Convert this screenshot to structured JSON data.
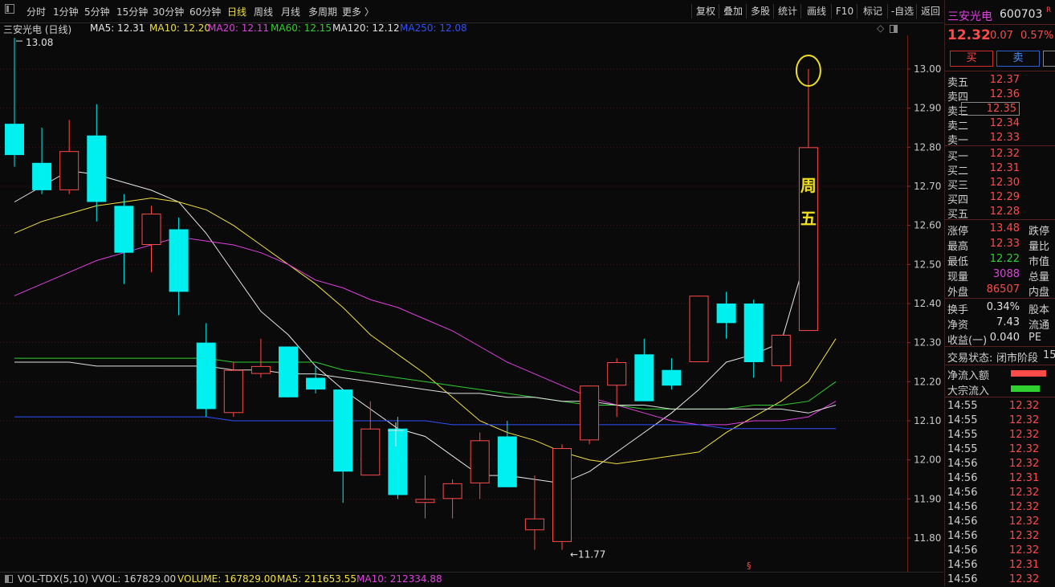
{
  "toolbar": {
    "periods": [
      "分时",
      "1分钟",
      "5分钟",
      "15分钟",
      "30分钟",
      "60分钟",
      "日线",
      "周线",
      "月线",
      "多周期",
      "更多 〉"
    ],
    "active_period": "日线",
    "right_buttons": [
      "复权",
      "叠加",
      "多股",
      "统计",
      "画线",
      "F10",
      "标记",
      "-自选",
      "返回"
    ]
  },
  "info_line": {
    "title": "三安光电 (日线)",
    "ma": [
      {
        "label": "MA5: 12.31",
        "color": "#e8e8e8"
      },
      {
        "label": "MA10: 12.20",
        "color": "#f0e040"
      },
      {
        "label": "MA20: 12.11",
        "color": "#e040e0"
      },
      {
        "label": "MA60: 12.15",
        "color": "#30d030"
      },
      {
        "label": "MA120: 12.12",
        "color": "#e0e0e0"
      },
      {
        "label": "MA250: 12.08",
        "color": "#3050ff"
      }
    ]
  },
  "annotation": {
    "line1": "周",
    "line2": "五",
    "color": "#f0e020"
  },
  "markers": {
    "high_label": "13.08",
    "low_label": "←11.77",
    "small_mark": "§"
  },
  "chart_data": {
    "type": "candlestick",
    "y_ticks": [
      "13.00",
      "12.90",
      "12.80",
      "12.70",
      "12.60",
      "12.50",
      "12.40",
      "12.30",
      "12.20",
      "12.10",
      "12.00",
      "11.90",
      "11.80"
    ],
    "ylim": [
      11.77,
      13.08
    ],
    "candles": [
      {
        "o": 12.86,
        "h": 13.08,
        "l": 12.75,
        "c": 12.78
      },
      {
        "o": 12.76,
        "h": 12.85,
        "l": 12.68,
        "c": 12.69
      },
      {
        "o": 12.69,
        "h": 12.87,
        "l": 12.68,
        "c": 12.79
      },
      {
        "o": 12.83,
        "h": 12.91,
        "l": 12.61,
        "c": 12.66
      },
      {
        "o": 12.65,
        "h": 12.68,
        "l": 12.45,
        "c": 12.53
      },
      {
        "o": 12.55,
        "h": 12.65,
        "l": 12.48,
        "c": 12.63
      },
      {
        "o": 12.59,
        "h": 12.62,
        "l": 12.37,
        "c": 12.43
      },
      {
        "o": 12.3,
        "h": 12.35,
        "l": 12.11,
        "c": 12.13
      },
      {
        "o": 12.12,
        "h": 12.25,
        "l": 12.11,
        "c": 12.23
      },
      {
        "o": 12.22,
        "h": 12.31,
        "l": 12.21,
        "c": 12.24
      },
      {
        "o": 12.29,
        "h": 12.29,
        "l": 12.16,
        "c": 12.16
      },
      {
        "o": 12.21,
        "h": 12.24,
        "l": 12.17,
        "c": 12.18
      },
      {
        "o": 12.18,
        "h": 12.18,
        "l": 11.89,
        "c": 11.97
      },
      {
        "o": 11.96,
        "h": 12.15,
        "l": 11.96,
        "c": 12.08
      },
      {
        "o": 12.08,
        "h": 12.11,
        "l": 11.9,
        "c": 11.91
      },
      {
        "o": 11.89,
        "h": 11.96,
        "l": 11.85,
        "c": 11.9
      },
      {
        "o": 11.9,
        "h": 11.95,
        "l": 11.85,
        "c": 11.94
      },
      {
        "o": 11.94,
        "h": 12.07,
        "l": 11.9,
        "c": 12.05
      },
      {
        "o": 12.06,
        "h": 12.1,
        "l": 11.93,
        "c": 11.93
      },
      {
        "o": 11.82,
        "h": 11.96,
        "l": 11.77,
        "c": 11.85
      },
      {
        "o": 11.79,
        "h": 12.04,
        "l": 11.77,
        "c": 12.03
      },
      {
        "o": 12.05,
        "h": 12.19,
        "l": 12.04,
        "c": 12.19
      },
      {
        "o": 12.19,
        "h": 12.26,
        "l": 12.11,
        "c": 12.25
      },
      {
        "o": 12.27,
        "h": 12.31,
        "l": 12.15,
        "c": 12.15
      },
      {
        "o": 12.23,
        "h": 12.26,
        "l": 12.18,
        "c": 12.19
      },
      {
        "o": 12.25,
        "h": 12.42,
        "l": 12.25,
        "c": 12.42
      },
      {
        "o": 12.4,
        "h": 12.43,
        "l": 12.31,
        "c": 12.35
      },
      {
        "o": 12.4,
        "h": 12.41,
        "l": 12.21,
        "c": 12.25
      },
      {
        "o": 12.24,
        "h": 12.32,
        "l": 12.2,
        "c": 12.32
      },
      {
        "o": 12.33,
        "h": 13.0,
        "l": 12.33,
        "c": 12.8
      }
    ],
    "ma_lines": [
      {
        "name": "MA5",
        "color": "#e8e8e8",
        "values": [
          12.66,
          12.7,
          12.74,
          12.73,
          12.71,
          12.69,
          12.66,
          12.58,
          12.48,
          12.38,
          12.32,
          12.24,
          12.18,
          12.13,
          12.08,
          12.06,
          12.01,
          11.96,
          11.96,
          11.95,
          11.94,
          11.97,
          12.02,
          12.07,
          12.12,
          12.18,
          12.25,
          12.27,
          12.3,
          12.54
        ]
      },
      {
        "name": "MA10",
        "color": "#f0e040",
        "values": [
          12.58,
          12.61,
          12.63,
          12.65,
          12.66,
          12.67,
          12.66,
          12.64,
          12.6,
          12.55,
          12.5,
          12.45,
          12.39,
          12.32,
          12.27,
          12.22,
          12.16,
          12.1,
          12.07,
          12.05,
          12.02,
          12.0,
          11.99,
          12.0,
          12.01,
          12.02,
          12.07,
          12.11,
          12.15,
          12.2,
          12.31
        ]
      },
      {
        "name": "MA20",
        "color": "#e040e0",
        "values": [
          12.42,
          12.45,
          12.48,
          12.51,
          12.53,
          12.55,
          12.57,
          12.56,
          12.55,
          12.53,
          12.5,
          12.46,
          12.44,
          12.41,
          12.39,
          12.36,
          12.33,
          12.29,
          12.25,
          12.22,
          12.19,
          12.16,
          12.14,
          12.12,
          12.1,
          12.09,
          12.09,
          12.1,
          12.1,
          12.11,
          12.15
        ]
      },
      {
        "name": "MA60",
        "color": "#30d030",
        "values": [
          12.26,
          12.26,
          12.26,
          12.26,
          12.26,
          12.26,
          12.26,
          12.26,
          12.25,
          12.25,
          12.25,
          12.25,
          12.23,
          12.22,
          12.21,
          12.2,
          12.19,
          12.18,
          12.17,
          12.16,
          12.15,
          12.14,
          12.14,
          12.13,
          12.13,
          12.13,
          12.13,
          12.14,
          12.14,
          12.15,
          12.2
        ]
      },
      {
        "name": "MA120",
        "color": "#e0e0e0",
        "values": [
          12.25,
          12.25,
          12.25,
          12.24,
          12.24,
          12.24,
          12.24,
          12.24,
          12.23,
          12.23,
          12.22,
          12.22,
          12.21,
          12.2,
          12.19,
          12.18,
          12.17,
          12.17,
          12.16,
          12.16,
          12.15,
          12.15,
          12.14,
          12.14,
          12.13,
          12.13,
          12.13,
          12.13,
          12.13,
          12.12,
          12.14
        ]
      },
      {
        "name": "MA250",
        "color": "#3050ff",
        "values": [
          12.11,
          12.11,
          12.11,
          12.11,
          12.11,
          12.11,
          12.11,
          12.11,
          12.1,
          12.1,
          12.1,
          12.1,
          12.1,
          12.1,
          12.1,
          12.1,
          12.09,
          12.09,
          12.09,
          12.09,
          12.09,
          12.09,
          12.09,
          12.09,
          12.09,
          12.09,
          12.08,
          12.08,
          12.08,
          12.08,
          12.08
        ]
      }
    ]
  },
  "volume_bar": {
    "items": [
      {
        "label": "VOL-TDX(5,10)",
        "color": "#d0d0d0"
      },
      {
        "label": "VVOL: 167829.00",
        "color": "#d0d0d0"
      },
      {
        "label": "VOLUME: 167829.00",
        "color": "#f0e040"
      },
      {
        "label": "MA5: 211653.55",
        "color": "#f0e040"
      },
      {
        "label": "MA10: 212334.88",
        "color": "#e040e0"
      }
    ]
  },
  "stock": {
    "name": "三安光电",
    "code": "600703",
    "r_mark": "R",
    "price": "12.32",
    "change": "0.07",
    "change_pct": "0.57%",
    "buy_label": "买",
    "sell_label": "卖"
  },
  "order_book": {
    "asks": [
      {
        "label": "卖五",
        "price": "12.37"
      },
      {
        "label": "卖四",
        "price": "12.36"
      },
      {
        "label": "卖三",
        "price": "12.35"
      },
      {
        "label": "卖二",
        "price": "12.34"
      },
      {
        "label": "卖一",
        "price": "12.33"
      }
    ],
    "bids": [
      {
        "label": "买一",
        "price": "12.32"
      },
      {
        "label": "买二",
        "price": "12.31"
      },
      {
        "label": "买三",
        "price": "12.30"
      },
      {
        "label": "买四",
        "price": "12.29"
      },
      {
        "label": "买五",
        "price": "12.28"
      }
    ]
  },
  "stats": [
    {
      "label": "涨停",
      "value": "13.48",
      "cut": "跌停",
      "color": "#ff4a4a"
    },
    {
      "label": "最高",
      "value": "12.33",
      "cut": "量比",
      "color": "#ff4a4a"
    },
    {
      "label": "最低",
      "value": "12.22",
      "cut": "市值",
      "color": "#30d030"
    },
    {
      "label": "现量",
      "value": "3088",
      "cut": "总量",
      "color": "#e040e0"
    },
    {
      "label": "外盘",
      "value": "86507",
      "cut": "内盘",
      "color": "#ff4a4a"
    }
  ],
  "stats2": [
    {
      "label": "换手",
      "value": "0.34%",
      "cut": "股本"
    },
    {
      "label": "净资",
      "value": "7.43",
      "cut": "流通"
    },
    {
      "label": "收益(一)",
      "value": "0.040",
      "cut": "PE"
    }
  ],
  "status": {
    "label": "交易状态:",
    "value": "闭市阶段",
    "cut": "15"
  },
  "flows": [
    {
      "label": "净流入额",
      "color": "#ff4a4a"
    },
    {
      "label": "大宗流入",
      "color": "#30d030"
    }
  ],
  "ticks": [
    {
      "time": "14:55",
      "price": "12.32"
    },
    {
      "time": "14:55",
      "price": "12.32"
    },
    {
      "time": "14:55",
      "price": "12.32"
    },
    {
      "time": "14:55",
      "price": "12.32"
    },
    {
      "time": "14:56",
      "price": "12.32"
    },
    {
      "time": "14:56",
      "price": "12.31"
    },
    {
      "time": "14:56",
      "price": "12.32"
    },
    {
      "time": "14:56",
      "price": "12.32"
    },
    {
      "time": "14:56",
      "price": "12.32"
    },
    {
      "time": "14:56",
      "price": "12.32"
    },
    {
      "time": "14:56",
      "price": "12.32"
    },
    {
      "time": "14:56",
      "price": "12.31"
    },
    {
      "time": "14:56",
      "price": "12.32"
    }
  ]
}
